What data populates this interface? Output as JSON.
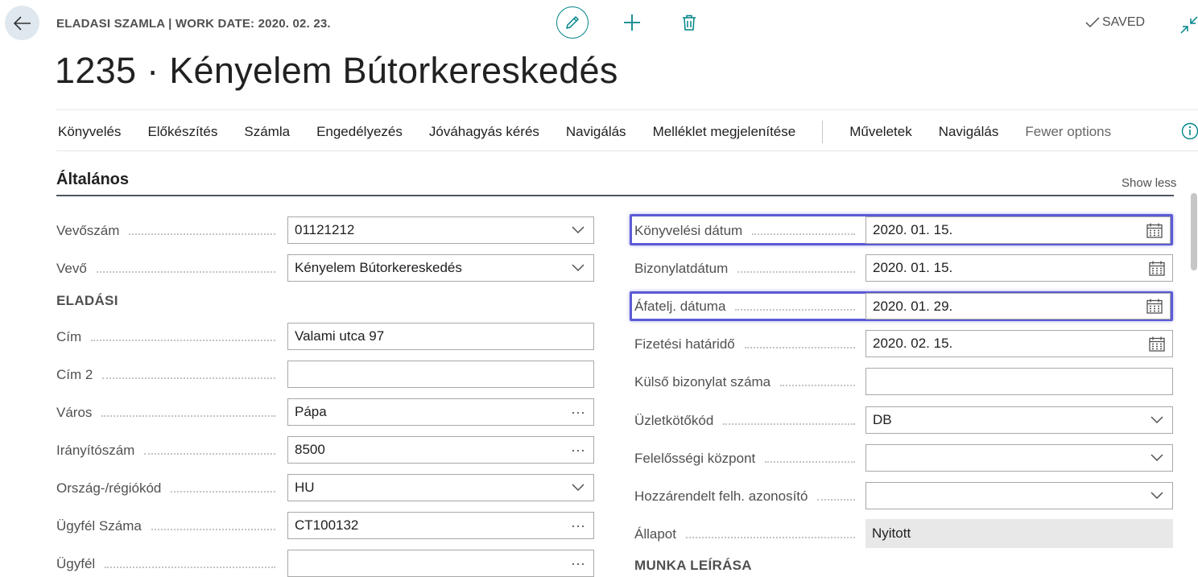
{
  "header": {
    "caption": "ELADASI SZAMLA | WORK DATE: 2020. 02. 23.",
    "title": "1235 · Kényelem Bútorkereskedés",
    "saved_label": "SAVED"
  },
  "actions": [
    "Könyvelés",
    "Előkészítés",
    "Számla",
    "Engedélyezés",
    "Jóváhagyás kérés",
    "Navigálás",
    "Melléklet megjelenítése"
  ],
  "actions2": [
    "Műveletek",
    "Navigálás"
  ],
  "fewer_options": "Fewer options",
  "section": {
    "title": "Általános",
    "show_less": "Show less"
  },
  "left": {
    "customer_no": {
      "label": "Vevőszám",
      "value": "01121212"
    },
    "customer": {
      "label": "Vevő",
      "value": "Kényelem Bútorkereskedés"
    },
    "subhead": "ELADÁSI",
    "address": {
      "label": "Cím",
      "value": "Valami  utca  97"
    },
    "address2": {
      "label": "Cím 2",
      "value": ""
    },
    "city": {
      "label": "Város",
      "value": "Pápa"
    },
    "postcode": {
      "label": "Irányítószám",
      "value": "8500"
    },
    "country": {
      "label": "Ország-/régiókód",
      "value": "HU"
    },
    "client_no": {
      "label": "Ügyfél Száma",
      "value": "CT100132"
    },
    "client": {
      "label": "Ügyfél",
      "value": ""
    }
  },
  "right": {
    "posting_date": {
      "label": "Könyvelési dátum",
      "value": "2020. 01. 15."
    },
    "document_date": {
      "label": "Bizonylatdátum",
      "value": "2020. 01. 15."
    },
    "vat_date": {
      "label": "Áfatelj. dátuma",
      "value": "2020. 01. 29."
    },
    "due_date": {
      "label": "Fizetési határidő",
      "value": "2020. 02. 15."
    },
    "external_doc": {
      "label": "Külső bizonylat száma",
      "value": ""
    },
    "salesperson": {
      "label": "Üzletkötőkód",
      "value": "DB"
    },
    "responsibility": {
      "label": "Felelősségi központ",
      "value": ""
    },
    "assigned_user": {
      "label": "Hozzárendelt felh. azonosító",
      "value": ""
    },
    "status": {
      "label": "Állapot",
      "value": "Nyitott"
    },
    "subhead": "MUNKA LEÍRÁSA"
  },
  "colors": {
    "accent": "#008489",
    "highlight": "#5b5bd6",
    "section_line": "#505563"
  }
}
